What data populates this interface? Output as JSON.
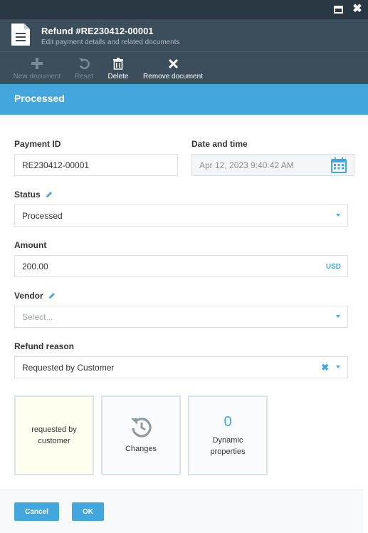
{
  "window": {
    "maximize_icon": "maximize-icon",
    "close_icon": "close-icon"
  },
  "header": {
    "title": "Refund #RE230412-00001",
    "subtitle": "Edit payment details and related documents",
    "icon": "document-icon"
  },
  "toolbar": {
    "new_document": "New document",
    "reset": "Reset",
    "delete": "Delete",
    "remove_document": "Remove document"
  },
  "status_banner": "Processed",
  "form": {
    "payment_id": {
      "label": "Payment ID",
      "value": "RE230412-00001"
    },
    "date_time": {
      "label": "Date and time",
      "value": "Apr 12, 2023 9:40:42 AM"
    },
    "status": {
      "label": "Status",
      "value": "Processed"
    },
    "amount": {
      "label": "Amount",
      "value": "200.00",
      "currency": "USD"
    },
    "vendor": {
      "label": "Vendor",
      "placeholder": "Select..."
    },
    "refund_reason": {
      "label": "Refund reason",
      "value": "Requested by Customer"
    }
  },
  "widgets": {
    "note": "requested by customer",
    "changes": "Changes",
    "dynamic_count": "0",
    "dynamic_label": "Dynamic properties"
  },
  "footer": {
    "cancel": "Cancel",
    "ok": "OK"
  },
  "colors": {
    "accent": "#43a6dd",
    "header_bg": "#3c4d5c",
    "titlebar_bg": "#2a3844"
  }
}
